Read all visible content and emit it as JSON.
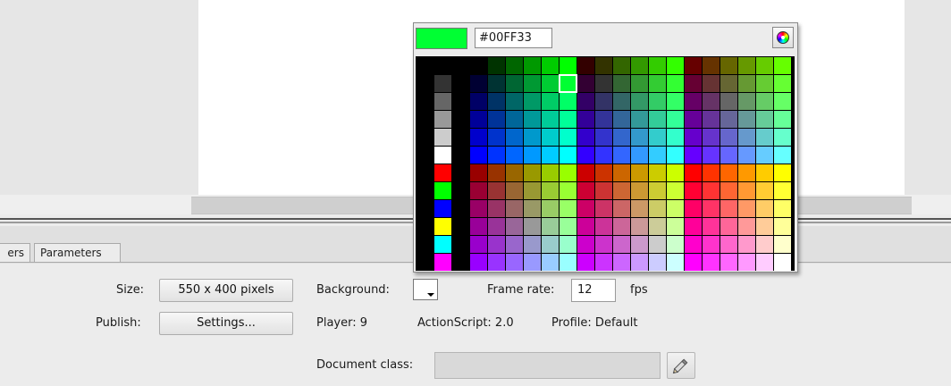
{
  "tabs": [
    {
      "label": "ers"
    },
    {
      "label": "Parameters"
    }
  ],
  "properties": {
    "size_label": "Size:",
    "size_value": "550 x 400 pixels",
    "background_label": "Background:",
    "background_color": "#ffffff",
    "frame_rate_label": "Frame rate:",
    "frame_rate_value": "12",
    "fps_label": "fps",
    "publish_label": "Publish:",
    "settings_label": "Settings...",
    "player": "Player:  9",
    "actionscript": "ActionScript: 2.0",
    "profile": "Profile:  Default",
    "document_class_label": "Document class:",
    "document_class_value": ""
  },
  "color_picker": {
    "hex_value": "#00FF33",
    "current_color": "#00FF33",
    "selected_swatch": "#00FF33",
    "left_column_colors": [
      "#000000",
      "#333333",
      "#666666",
      "#999999",
      "#CCCCCC",
      "#FFFFFF",
      "#FF0000",
      "#00FF00",
      "#0000FF",
      "#FFFF00",
      "#00FFFF",
      "#FF00FF"
    ],
    "icons": {
      "color_wheel": "color-wheel-icon"
    }
  },
  "icons": {
    "pencil": "pencil-icon",
    "dropdown": "triangle-down-icon"
  }
}
